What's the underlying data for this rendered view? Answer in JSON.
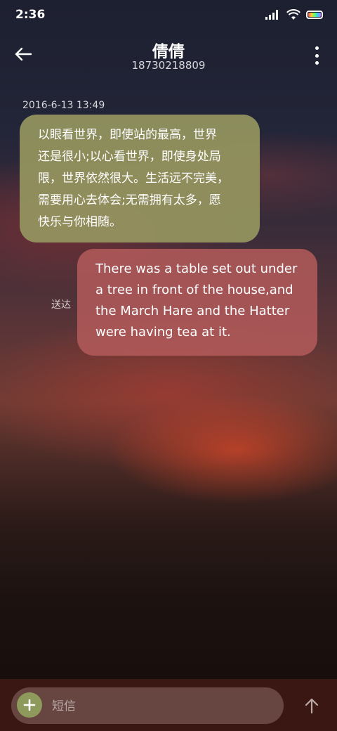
{
  "status_bar": {
    "time": "2:36",
    "icons": [
      "signal-icon",
      "wifi-icon",
      "battery-icon"
    ]
  },
  "header": {
    "contact_name": "倩倩",
    "contact_number": "18730218809",
    "back_icon": "arrow-left-icon",
    "more_icon": "more-vertical-icon"
  },
  "conversation": {
    "timestamp": "2016-6-13 13:49",
    "messages": [
      {
        "direction": "received",
        "lines": [
          "以眼看世界，即使站的最高，世界",
          "还是很小;以心看世界，即使身处局",
          "限，世界依然很大。生活远不完美，",
          "需要用心去体会;无需拥有太多，愿",
          "快乐与你相随。"
        ],
        "color": "#96965f"
      },
      {
        "direction": "sent",
        "lines": [
          "There was a table set out under",
          "a tree in front of the house,and",
          "the March Hare and the Hatter",
          "were having tea at it."
        ],
        "status": "送达",
        "color": "#b45a5a"
      }
    ]
  },
  "composer": {
    "placeholder": "短信",
    "value": "",
    "add_icon": "plus-icon",
    "send_icon": "arrow-up-icon",
    "accent": "#8e9a5c"
  }
}
